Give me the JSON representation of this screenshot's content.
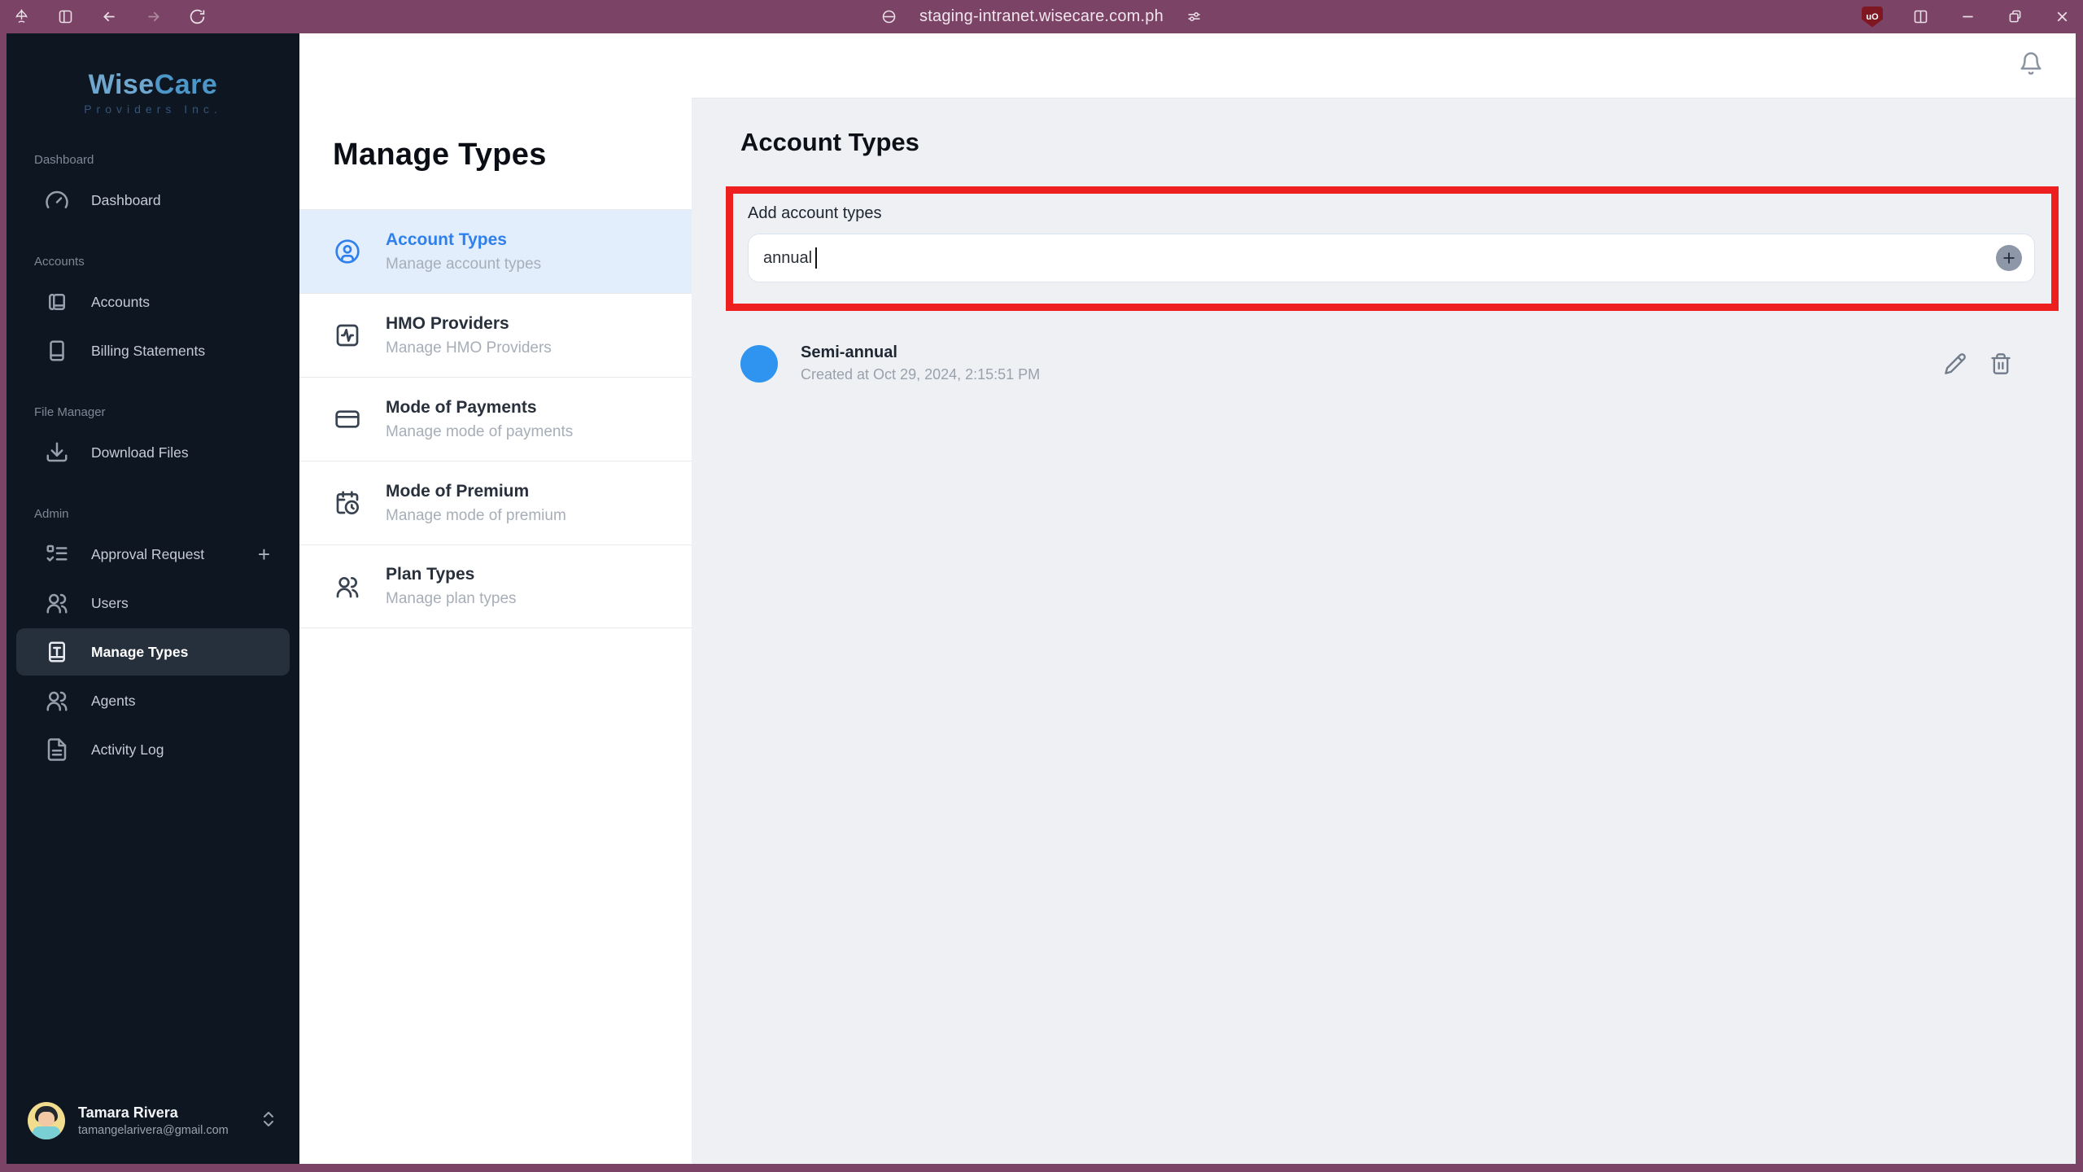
{
  "browser": {
    "url": "staging-intranet.wisecare.com.ph",
    "topbar_color": "#7b4365"
  },
  "sidebar": {
    "logo": {
      "brand_wise": "Wise",
      "brand_care": "Care",
      "tagline": "Providers Inc."
    },
    "sections": [
      {
        "label": "Dashboard",
        "items": [
          {
            "label": "Dashboard"
          }
        ]
      },
      {
        "label": "Accounts",
        "items": [
          {
            "label": "Accounts"
          },
          {
            "label": "Billing Statements"
          }
        ]
      },
      {
        "label": "File Manager",
        "items": [
          {
            "label": "Download Files"
          }
        ]
      },
      {
        "label": "Admin",
        "items": [
          {
            "label": "Approval Request",
            "trailing": "+"
          },
          {
            "label": "Users"
          },
          {
            "label": "Manage Types",
            "active": true
          },
          {
            "label": "Agents"
          },
          {
            "label": "Activity Log"
          }
        ]
      }
    ],
    "user": {
      "name": "Tamara Rivera",
      "email": "tamangelarivera@gmail.com"
    }
  },
  "manage_panel": {
    "title": "Manage Types",
    "items": [
      {
        "title": "Account Types",
        "subtitle": "Manage account types",
        "active": true
      },
      {
        "title": "HMO Providers",
        "subtitle": "Manage HMO Providers"
      },
      {
        "title": "Mode of Payments",
        "subtitle": "Manage mode of payments"
      },
      {
        "title": "Mode of Premium",
        "subtitle": "Manage mode of premium"
      },
      {
        "title": "Plan Types",
        "subtitle": "Manage plan types"
      }
    ]
  },
  "main": {
    "title": "Account Types",
    "add_label": "Add account types",
    "input_value": "annual",
    "list": [
      {
        "name": "Semi-annual",
        "created": "Created at Oct 29, 2024, 2:15:51 PM"
      }
    ]
  },
  "colors": {
    "accent_blue": "#2f80ed",
    "highlight_red": "#ee1f1f",
    "sidebar_bg": "#0e1621",
    "item_dot_blue": "#2e94ef"
  }
}
